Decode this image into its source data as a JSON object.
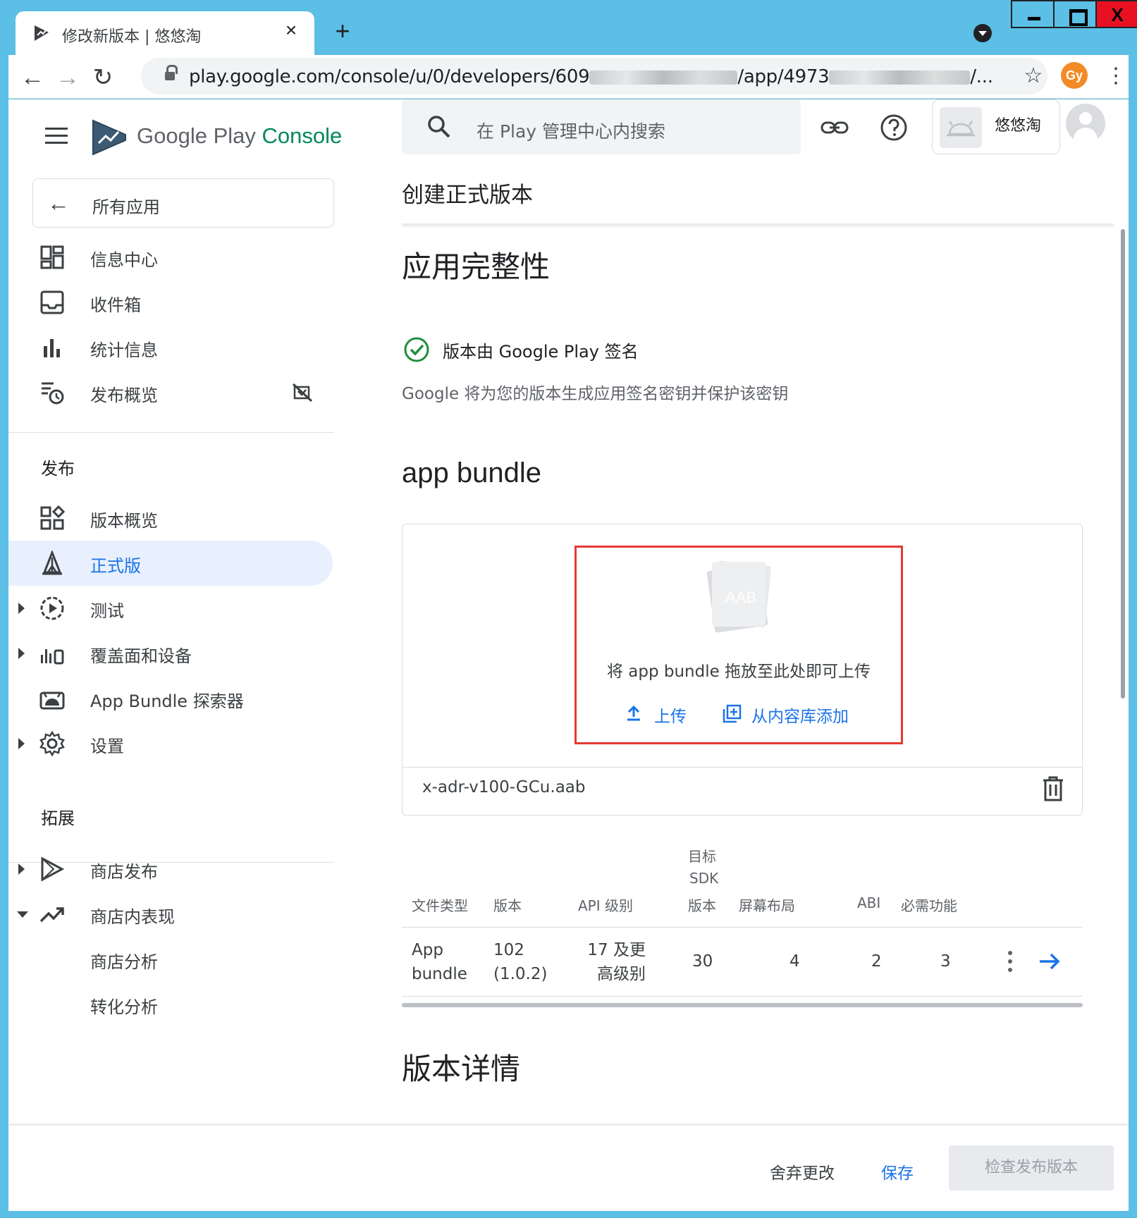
{
  "browser": {
    "tab_title": "修改新版本 | 悠悠淘",
    "tab_close": "×",
    "new_tab": "+",
    "url_prefix": "play.google.com/console/u/0/developers/609",
    "url_middle": "/app/4973",
    "url_suffix": "/...",
    "profile_initials": "Gy",
    "back": "←",
    "forward": "→",
    "reload": "↻",
    "star": "☆",
    "menu": "⋮",
    "window_close": "X"
  },
  "sidebar": {
    "brand_main": "Google Play",
    "brand_accent": "Console",
    "back_label": "所有应用",
    "back_arrow": "←",
    "items_top": [
      {
        "label": "信息中心",
        "icon": "dashboard-icon"
      },
      {
        "label": "收件箱",
        "icon": "inbox-icon"
      },
      {
        "label": "统计信息",
        "icon": "bar-chart-icon"
      },
      {
        "label": "发布概览",
        "icon": "publishing-overview-icon"
      }
    ],
    "section_release": "发布",
    "items_release": [
      {
        "label": "版本概览",
        "icon": "releases-overview-icon"
      },
      {
        "label": "正式版",
        "icon": "production-icon",
        "active": true
      },
      {
        "label": "测试",
        "icon": "testing-icon"
      },
      {
        "label": "覆盖面和设备",
        "icon": "reach-devices-icon"
      },
      {
        "label": "App Bundle 探索器",
        "icon": "android-icon"
      },
      {
        "label": "设置",
        "icon": "gear-icon"
      }
    ],
    "section_grow": "拓展",
    "items_grow": [
      {
        "label": "商店发布",
        "icon": "store-presence-icon"
      },
      {
        "label": "商店内表现",
        "icon": "trending-up-icon"
      },
      {
        "label": "商店分析"
      },
      {
        "label": "转化分析"
      }
    ]
  },
  "header": {
    "search_placeholder": "在 Play 管理中心内搜索",
    "account_name": "悠悠淘"
  },
  "main": {
    "page_title": "创建正式版本",
    "integrity_title": "应用完整性",
    "signed_label": "版本由 Google Play 签名",
    "signed_desc": "Google 将为您的版本生成应用签名密钥并保护该密钥",
    "bundle_title": "app bundle",
    "aab_label": ".AAB",
    "drop_text": "将 app bundle 拖放至此处即可上传",
    "upload_label": "上传",
    "library_label": "从内容库添加",
    "file_name": "x-adr-v100-GCu.aab",
    "table": {
      "headers": {
        "file_type": "文件类型",
        "version": "版本",
        "api_level": "API 级别",
        "target_sdk_1": "目标",
        "target_sdk_2": "SDK",
        "target_sdk_3": "版本",
        "screen_layout": "屏幕布局",
        "abi": "ABI",
        "required_features": "必需功能"
      },
      "row": {
        "file_type_1": "App",
        "file_type_2": "bundle",
        "version_1": "102",
        "version_2": "(1.0.2)",
        "api_1": "17 及更",
        "api_2": "高级别",
        "target_sdk": "30",
        "screen_layout": "4",
        "abi": "2",
        "required_features": "3"
      }
    },
    "details_title": "版本详情"
  },
  "footer": {
    "discard": "舍弃更改",
    "save": "保存",
    "review": "检查发布版本"
  },
  "colors": {
    "accent": "#1a73e8",
    "active_bg": "#e8f0fe",
    "success": "#1e8e3e",
    "highlight_border": "#e53935",
    "brand_green": "#01875f"
  }
}
